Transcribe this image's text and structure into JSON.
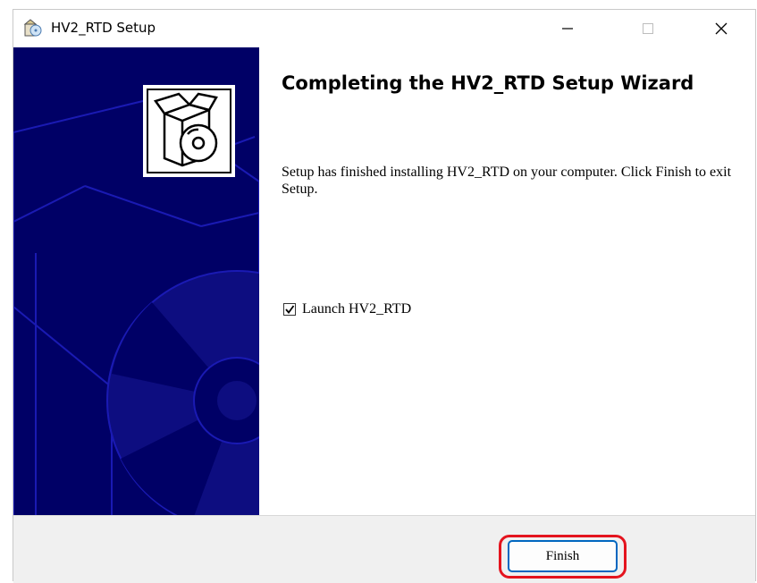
{
  "window": {
    "title": "HV2_RTD Setup",
    "icon": "installer-box-icon",
    "controls": {
      "minimize": "minimize-icon",
      "maximize": "maximize-icon",
      "close": "close-icon"
    }
  },
  "banner": {
    "icon": "box-with-disc-icon"
  },
  "content": {
    "heading": "Completing the HV2_RTD Setup Wizard",
    "body": "Setup has finished installing HV2_RTD on your computer. Click Finish to exit Setup.",
    "launch_checkbox": {
      "label": "Launch HV2_RTD",
      "checked": true
    }
  },
  "footer": {
    "finish_label": "Finish"
  },
  "colors": {
    "banner_bg": "#000066",
    "banner_line": "#1a1ab3",
    "highlight": "#e4141e",
    "accent": "#0067c0"
  }
}
